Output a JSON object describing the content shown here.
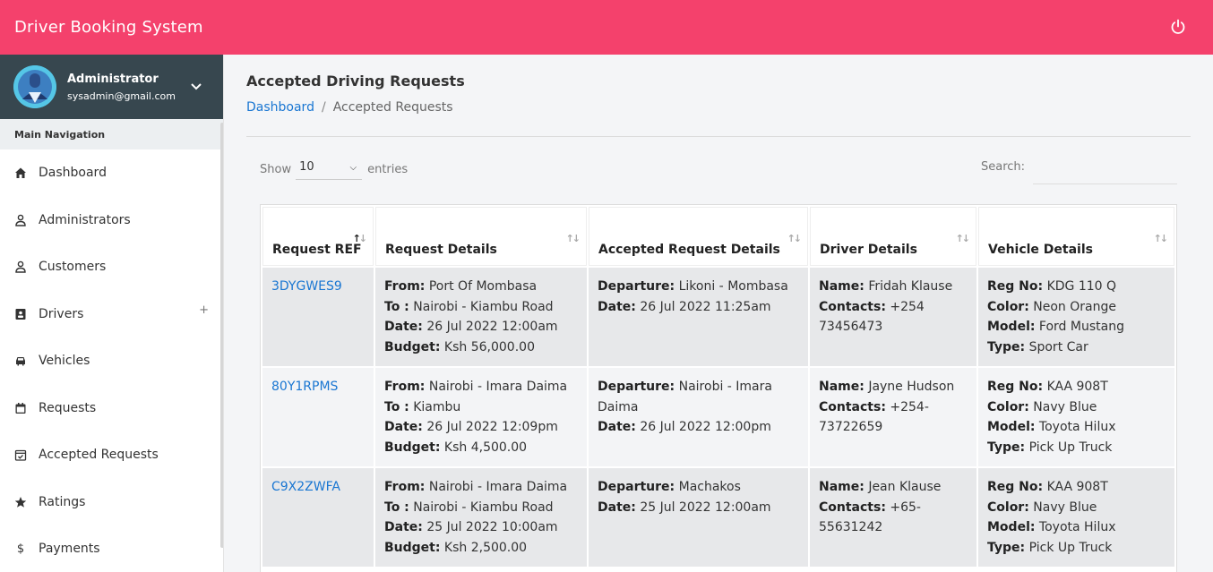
{
  "app": {
    "title": "Driver Booking System"
  },
  "user": {
    "name": "Administrator",
    "email": "sysadmin@gmail.com"
  },
  "nav": {
    "header": "Main Navigation",
    "items": [
      {
        "label": "Dashboard",
        "icon": "home-icon"
      },
      {
        "label": "Administrators",
        "icon": "person-icon"
      },
      {
        "label": "Customers",
        "icon": "person-icon"
      },
      {
        "label": "Drivers",
        "icon": "id-card-icon",
        "expand": "+"
      },
      {
        "label": "Vehicles",
        "icon": "car-icon"
      },
      {
        "label": "Requests",
        "icon": "calendar-icon"
      },
      {
        "label": "Accepted Requests",
        "icon": "calendar-check-icon"
      },
      {
        "label": "Ratings",
        "icon": "star-icon"
      },
      {
        "label": "Payments",
        "icon": "dollar-icon"
      }
    ]
  },
  "page": {
    "title": "Accepted Driving Requests",
    "breadcrumb": {
      "link": "Dashboard",
      "separator": "/",
      "current": "Accepted Requests"
    }
  },
  "table_controls": {
    "show_label": "Show",
    "entries_value": "10",
    "entries_label": "entries",
    "search_label": "Search:"
  },
  "table": {
    "headers": [
      "Request REF",
      "Request Details",
      "Accepted Request Details",
      "Driver Details",
      "Vehicle Details"
    ],
    "rows": [
      {
        "ref": "3DYGWES9",
        "from": "Port Of Mombasa",
        "to": "Nairobi - Kiambu Road",
        "date": "26 Jul 2022 12:00am",
        "budget": "Ksh 56,000.00",
        "departure": "Likoni - Mombasa",
        "acc_date": "26 Jul 2022 11:25am",
        "driver_name": "Fridah Klause",
        "contacts": "+254 73456473",
        "reg_no": "KDG 110 Q",
        "color": "Neon Orange",
        "model": "Ford Mustang",
        "type": "Sport Car"
      },
      {
        "ref": "80Y1RPMS",
        "from": "Nairobi - Imara Daima",
        "to": "Kiambu",
        "date": "26 Jul 2022 12:09pm",
        "budget": "Ksh 4,500.00",
        "departure": "Nairobi - Imara Daima",
        "acc_date": "26 Jul 2022 12:00pm",
        "driver_name": "Jayne Hudson",
        "contacts": "+254-73722659",
        "reg_no": "KAA 908T",
        "color": "Navy Blue",
        "model": "Toyota Hilux",
        "type": "Pick Up Truck"
      },
      {
        "ref": "C9X2ZWFA",
        "from": "Nairobi - Imara Daima",
        "to": "Nairobi - Kiambu Road",
        "date": "25 Jul 2022 10:00am",
        "budget": "Ksh 2,500.00",
        "departure": "Machakos",
        "acc_date": "25 Jul 2022 12:00am",
        "driver_name": "Jean Klause",
        "contacts": "+65-55631242",
        "reg_no": "KAA 908T",
        "color": "Navy Blue",
        "model": "Toyota Hilux",
        "type": "Pick Up Truck"
      }
    ]
  },
  "labels": {
    "from": "From:",
    "to": "To :",
    "date": "Date:",
    "budget": "Budget:",
    "departure": "Departure:",
    "acc_date": "Date:",
    "name": "Name:",
    "contacts": "Contacts:",
    "reg_no": "Reg No:",
    "color": "Color:",
    "model": "Model:",
    "type": "Type:"
  },
  "colors": {
    "topbar": "#f4416c",
    "user_panel": "#37474f",
    "link": "#1976d2"
  }
}
